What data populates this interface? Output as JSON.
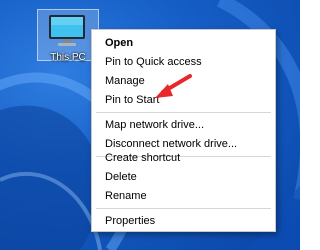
{
  "desktop": {
    "icon": {
      "label": "This PC",
      "icon": "monitor-icon"
    }
  },
  "context_menu": {
    "groups": [
      [
        {
          "label": "Open",
          "bold": true
        },
        {
          "label": "Pin to Quick access"
        },
        {
          "label": "Manage"
        },
        {
          "label": "Pin to Start",
          "highlighted_by_arrow": true
        }
      ],
      [
        {
          "label": "Map network drive..."
        },
        {
          "label": "Disconnect network drive..."
        }
      ],
      [
        {
          "label": "Create shortcut"
        },
        {
          "label": "Delete"
        },
        {
          "label": "Rename"
        }
      ],
      [
        {
          "label": "Properties"
        }
      ]
    ]
  },
  "annotation": {
    "arrow_color": "#e8282b"
  }
}
